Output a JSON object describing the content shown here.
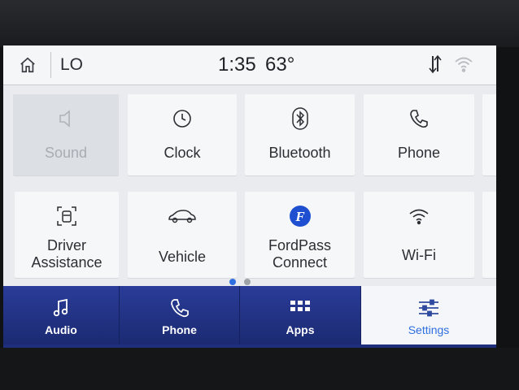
{
  "status_bar": {
    "climate": "LO",
    "time": "1:35",
    "temperature": "63°"
  },
  "tiles": [
    {
      "label": "Sound",
      "icon": "speaker-icon",
      "enabled": false
    },
    {
      "label": "Clock",
      "icon": "clock-icon",
      "enabled": true
    },
    {
      "label": "Bluetooth",
      "icon": "bluetooth-icon",
      "enabled": true
    },
    {
      "label": "Phone",
      "icon": "phone-icon",
      "enabled": true
    },
    {
      "label": "Driver Assistance",
      "icon": "driver-assist-icon",
      "enabled": true
    },
    {
      "label": "Vehicle",
      "icon": "car-icon",
      "enabled": true
    },
    {
      "label": "FordPass Connect",
      "icon": "fordpass-icon",
      "enabled": true
    },
    {
      "label": "Wi-Fi",
      "icon": "wifi-icon",
      "enabled": true
    }
  ],
  "pager": {
    "pages": 2,
    "current": 1
  },
  "nav": [
    {
      "label": "Audio",
      "icon": "music-note-icon"
    },
    {
      "label": "Phone",
      "icon": "phone-icon"
    },
    {
      "label": "Apps",
      "icon": "apps-grid-icon"
    },
    {
      "label": "Settings",
      "icon": "sliders-icon",
      "active": true
    }
  ],
  "colors": {
    "nav_bg": "#1f2f7e",
    "active_text": "#2f6fe0",
    "fordpass_blue": "#1f4fd1"
  }
}
